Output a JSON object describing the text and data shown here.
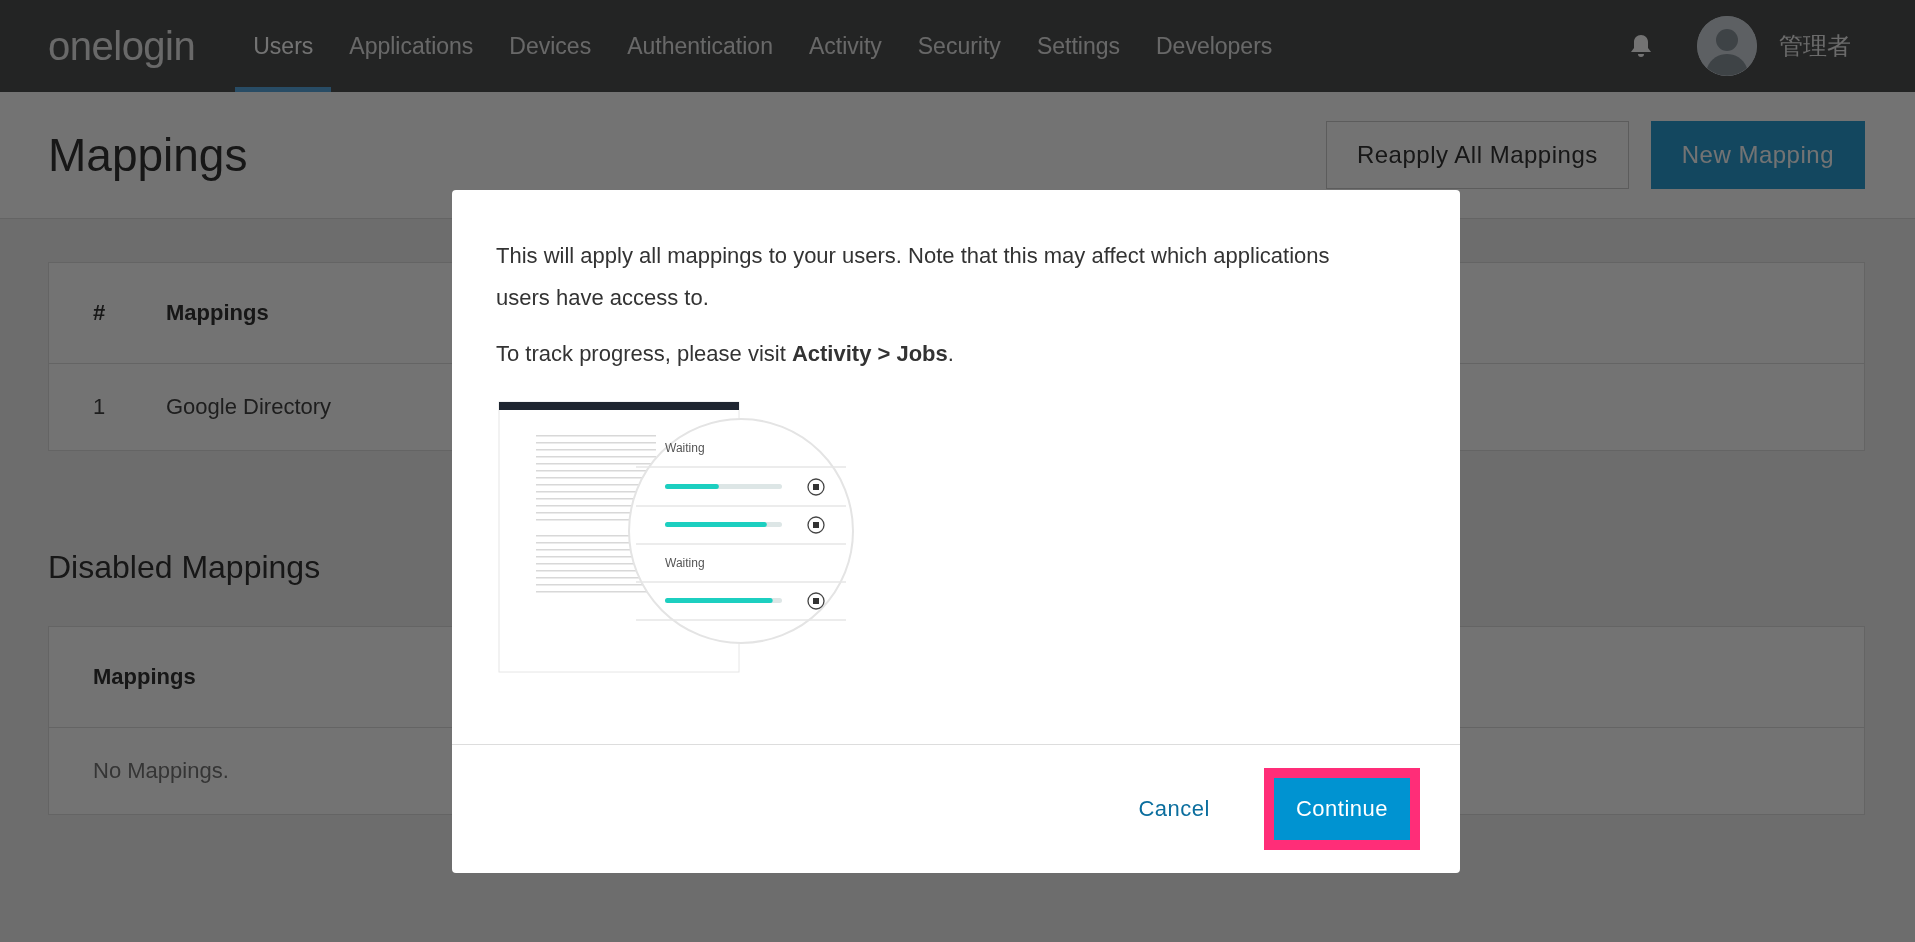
{
  "header": {
    "logo": "onelogin",
    "nav": [
      {
        "label": "Users",
        "selected": true
      },
      {
        "label": "Applications",
        "selected": false
      },
      {
        "label": "Devices",
        "selected": false
      },
      {
        "label": "Authentication",
        "selected": false
      },
      {
        "label": "Activity",
        "selected": false
      },
      {
        "label": "Security",
        "selected": false
      },
      {
        "label": "Settings",
        "selected": false
      },
      {
        "label": "Developers",
        "selected": false
      }
    ],
    "user_name": "管理者"
  },
  "page": {
    "title": "Mappings",
    "buttons": [
      {
        "label": "Reapply All Mappings",
        "kind": "secondary"
      },
      {
        "label": "New Mapping",
        "kind": "primary"
      }
    ]
  },
  "mappings_table": {
    "columns": [
      "#",
      "Mappings"
    ],
    "rows": [
      {
        "number": "1",
        "name": "Google Directory"
      }
    ]
  },
  "disabled_section": {
    "title": "Disabled Mappings",
    "columns": [
      "Mappings"
    ],
    "empty_message": "No Mappings."
  },
  "dialog": {
    "paragraphs": [
      "This will apply all mappings to your users. Note that this may affect which applications users have access to.",
      "To track progress, please visit **Activity > Jobs**."
    ],
    "illustration": {
      "jobs": [
        {
          "kind": "label",
          "text": "Waiting"
        },
        {
          "kind": "progress",
          "level": 0.46
        },
        {
          "kind": "progress",
          "level": 0.87
        },
        {
          "kind": "label",
          "text": "Waiting"
        },
        {
          "kind": "progress",
          "level": 0.92
        }
      ]
    },
    "buttons": [
      {
        "label": "Cancel",
        "kind": "link",
        "highlighted": false
      },
      {
        "label": "Continue",
        "kind": "primary",
        "highlighted": true
      }
    ]
  }
}
